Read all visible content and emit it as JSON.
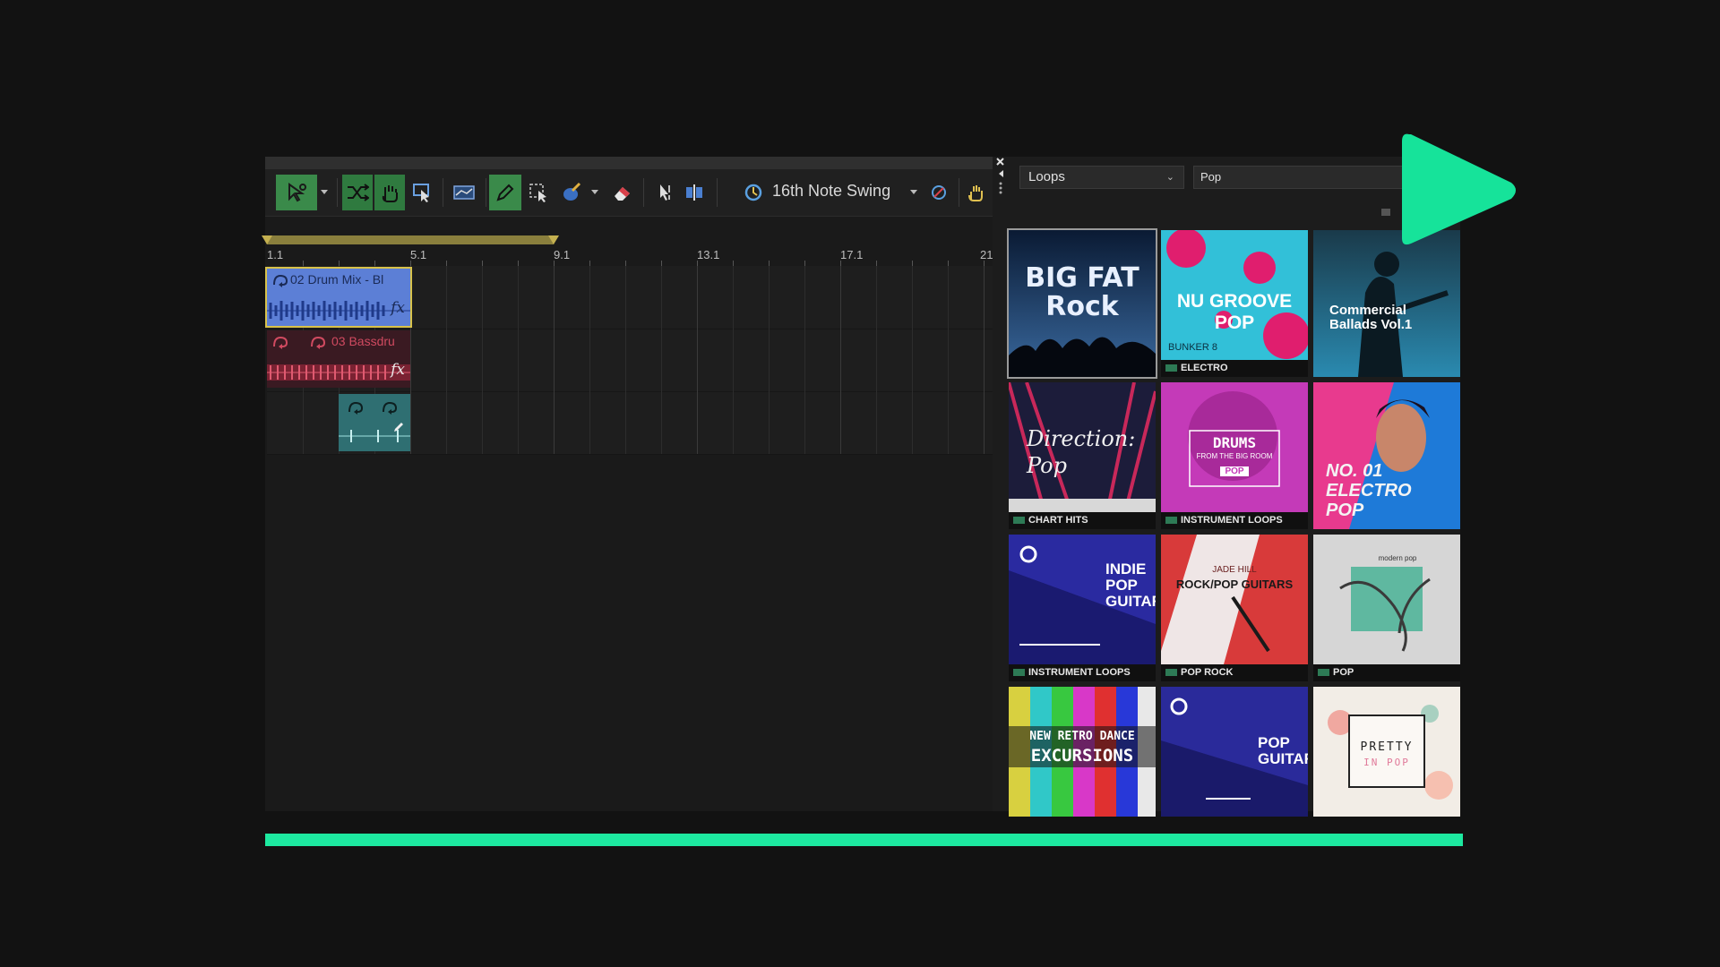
{
  "toolbar": {
    "swing_label": "16th Note Swing"
  },
  "timeline": {
    "ruler_labels": [
      "1.1",
      "5.1",
      "9.1",
      "13.1",
      "17.1",
      "21"
    ]
  },
  "clips": {
    "drum_mix_title": "02 Drum Mix - Bl",
    "bassdrum_title": "03 Bassdru",
    "fx_label": "fx"
  },
  "browser": {
    "loops_select": "Loops",
    "genre_input": "Pop"
  },
  "tiles": [
    {
      "title": "BIG FAT Rock",
      "caption": ""
    },
    {
      "title": "NU GROOVE POP",
      "sub": "BUNKER 8",
      "caption": "ELECTRO"
    },
    {
      "title": "Commercial Ballads Vol.1",
      "caption": ""
    },
    {
      "title": "Direction: Pop",
      "caption": "CHART HITS"
    },
    {
      "title": "DRUMS",
      "sub": "FROM THE BIG ROOM",
      "tag": "POP",
      "caption": "INSTRUMENT LOOPS"
    },
    {
      "title": "NO. 01 ELECTRO POP",
      "caption": ""
    },
    {
      "title": "INDIE POP GUITAR",
      "caption": "INSTRUMENT LOOPS"
    },
    {
      "title": "ROCK/POP GUITARS",
      "sub": "JADE HILL",
      "caption": "POP ROCK"
    },
    {
      "title": "modern pop",
      "caption": "POP"
    },
    {
      "title": "NEW RETRO DANCE",
      "sub": "EXCURSIONS",
      "caption": ""
    },
    {
      "title": "POP GUITAR",
      "caption": ""
    },
    {
      "title": "PRETTY",
      "sub": "IN POP",
      "caption": ""
    }
  ],
  "progress": {
    "fraction": 1.0
  },
  "colors": {
    "accent": "#1de9a0",
    "active_tool": "#3a8a4a",
    "drum_clip": "#5c7fd6",
    "bass_clip": "#b0334a",
    "teal_clip": "#2f6f72"
  }
}
